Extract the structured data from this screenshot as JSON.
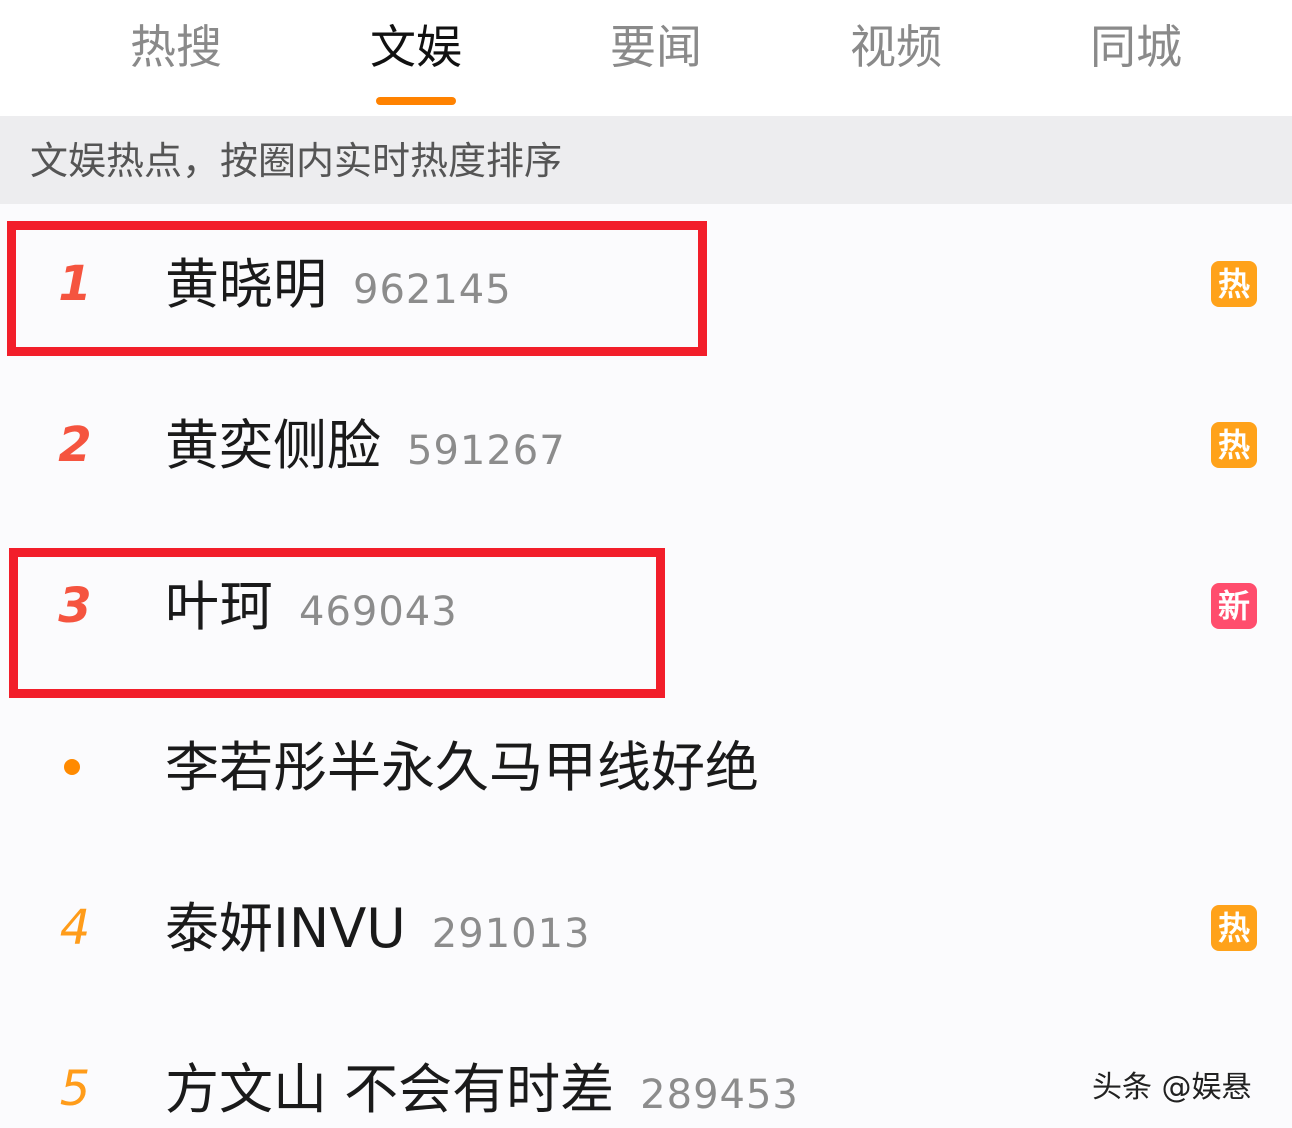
{
  "tabs": [
    {
      "label": "热搜"
    },
    {
      "label": "文娱"
    },
    {
      "label": "要闻"
    },
    {
      "label": "视频"
    },
    {
      "label": "同城"
    }
  ],
  "active_tab": "文娱",
  "notice": "文娱热点，按圈内实时热度排序",
  "items": [
    {
      "rank": "1",
      "title": "黄晓明",
      "heat": "962145",
      "badge": "热"
    },
    {
      "rank": "2",
      "title": "黄奕侧脸",
      "heat": "591267",
      "badge": "热"
    },
    {
      "rank": "3",
      "title": "叶珂",
      "heat": "469043",
      "badge": "新"
    },
    {
      "rank": "",
      "title": "李若彤半永久马甲线好绝",
      "heat": "",
      "badge": ""
    },
    {
      "rank": "4",
      "title": "泰妍INVU",
      "heat": "291013",
      "badge": "热"
    },
    {
      "rank": "5",
      "title": "方文山 不会有时差",
      "heat": "289453",
      "badge": ""
    }
  ],
  "watermark": "头条 @娱悬",
  "colors": {
    "accent": "#ff8200",
    "rank_top": "#f5543f",
    "rank_normal": "#ff9c1a",
    "badge_hot": "#ffa21a",
    "badge_new": "#ff4d6d",
    "highlight_box": "#f21e2a"
  }
}
